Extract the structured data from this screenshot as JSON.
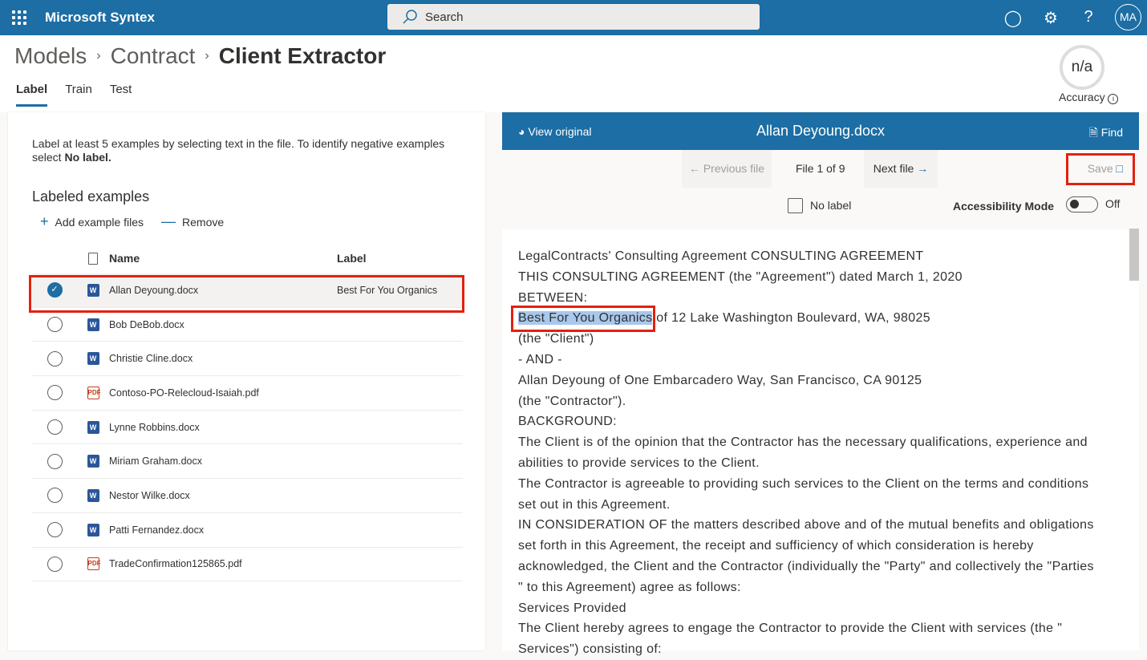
{
  "app": {
    "name": "Microsoft Syntex",
    "search_placeholder": "Search",
    "avatar": "MA"
  },
  "breadcrumb": [
    "Models",
    "Contract",
    "Client Extractor"
  ],
  "tabs": [
    "Label",
    "Train",
    "Test"
  ],
  "accuracy": {
    "value": "n/a",
    "label": "Accuracy"
  },
  "left": {
    "instruction": "Label at least 5 examples by selecting text in the file. To identify negative examples select ",
    "instruction_bold": "No label.",
    "heading": "Labeled examples",
    "add": "Add example files",
    "remove": "Remove",
    "columns": {
      "name": "Name",
      "label": "Label"
    },
    "files": [
      {
        "name": "Allan Deyoung.docx",
        "type": "word",
        "label": "Best For You Organics",
        "selected": true
      },
      {
        "name": "Bob DeBob.docx",
        "type": "word",
        "label": ""
      },
      {
        "name": "Christie Cline.docx",
        "type": "word",
        "label": ""
      },
      {
        "name": "Contoso-PO-Relecloud-Isaiah.pdf",
        "type": "pdf",
        "label": ""
      },
      {
        "name": "Lynne Robbins.docx",
        "type": "word",
        "label": ""
      },
      {
        "name": "Miriam Graham.docx",
        "type": "word",
        "label": ""
      },
      {
        "name": "Nestor Wilke.docx",
        "type": "word",
        "label": ""
      },
      {
        "name": "Patti Fernandez.docx",
        "type": "word",
        "label": ""
      },
      {
        "name": "TradeConfirmation125865.pdf",
        "type": "pdf",
        "label": ""
      }
    ]
  },
  "viewer": {
    "view_original": "View original",
    "title": "Allan Deyoung.docx",
    "find": "Find",
    "previous": "Previous file",
    "file_count": "File 1 of 9",
    "next": "Next file",
    "save": "Save",
    "no_label": "No label",
    "accessibility": "Accessibility Mode",
    "toggle_state": "Off",
    "highlight": "Best For You Organics",
    "highlight_rest": " of 12 Lake Washington Boulevard, WA, 98025",
    "lines_before": [
      "LegalContracts' Consulting Agreement CONSULTING AGREEMENT",
      "THIS CONSULTING AGREEMENT (the \"Agreement\") dated March 1, 2020",
      "BETWEEN:"
    ],
    "lines_after": [
      "(the \"Client\")",
      "- AND -",
      "Allan Deyoung of One Embarcadero Way, San Francisco, CA 90125",
      "(the \"Contractor\").",
      "BACKGROUND:",
      "The Client is of the opinion that the Contractor has the necessary qualifications, experience and",
      "abilities to provide services to the Client.",
      "The Contractor is agreeable to providing such services to the Client on the terms and conditions",
      "set out in this Agreement.",
      "IN CONSIDERATION OF the matters described above and of the mutual benefits and obligations",
      "set forth in this Agreement, the receipt and sufficiency of which consideration is hereby",
      "acknowledged, the Client and the Contractor (individually the \"Party\" and collectively the \"Parties",
      "\" to this Agreement) agree as follows:",
      "Services Provided",
      "The Client hereby agrees to engage the Contractor to provide the Client with services (the \"",
      "Services\") consisting of:"
    ]
  }
}
